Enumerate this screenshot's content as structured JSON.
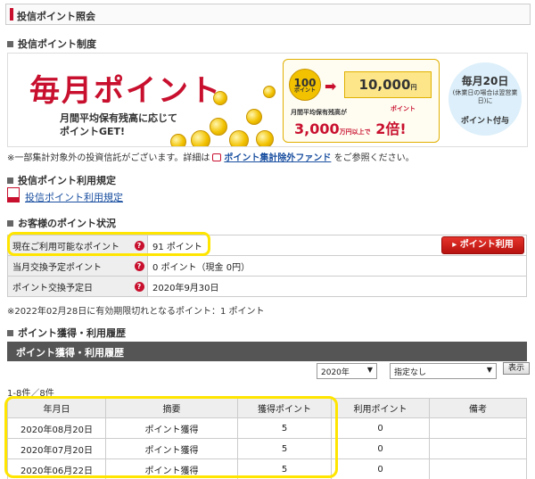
{
  "page_title": "投信ポイント照会",
  "sections": {
    "system": "投信ポイント制度",
    "rules": "投信ポイント利用規定",
    "status": "お客様のポイント状況",
    "history": "ポイント獲得・利用履歴"
  },
  "banner": {
    "headline": "毎月ポイント",
    "sub1": "月間平均保有残高に応じて",
    "sub2": "ポイントGET!",
    "amount_from": "100",
    "amount_from_unit": "ポイント",
    "amount_to": "10,000",
    "amount_to_unit": "円",
    "balance_label": "月間平均保有残高が",
    "point_label": "ポイント",
    "threshold": "3,000",
    "threshold_unit": "万円以上で",
    "double": "2倍!",
    "day_title": "毎月20日",
    "day_note": "(休業日の場合は翌営業日)に",
    "day_action": "ポイント付与"
  },
  "note_excluded": {
    "before": "※一部集計対象外の投資信託がございます。詳細は",
    "link": "ポイント集計除外ファンド",
    "after": "をご参照ください。"
  },
  "rules_link": "投信ポイント利用規定",
  "status": {
    "rows": [
      {
        "label": "現在ご利用可能なポイント",
        "value": "91 ポイント"
      },
      {
        "label": "当月交換予定ポイント",
        "value": "0 ポイント（現金 0円）"
      },
      {
        "label": "ポイント交換予定日",
        "value": "2020年9月30日"
      }
    ],
    "help_glyph": "?",
    "use_button": "ポイント利用",
    "expiry_note": "※2022年02月28日に有効期限切れとなるポイント：1 ポイント"
  },
  "history": {
    "bar_title": "ポイント獲得・利用履歴",
    "year_select": "2020年",
    "type_select": "指定なし",
    "show_button": "表示",
    "count": "1-8件／8件",
    "columns": [
      "年月日",
      "摘要",
      "獲得ポイント",
      "利用ポイント",
      "備考"
    ],
    "rows": [
      [
        "2020年08月20日",
        "ポイント獲得",
        "5",
        "0",
        ""
      ],
      [
        "2020年07月20日",
        "ポイント獲得",
        "5",
        "0",
        ""
      ],
      [
        "2020年06月22日",
        "ポイント獲得",
        "5",
        "0",
        ""
      ]
    ]
  },
  "colors": {
    "accent": "#c8102e",
    "highlight": "#ffe500",
    "dark_bar": "#555555"
  }
}
